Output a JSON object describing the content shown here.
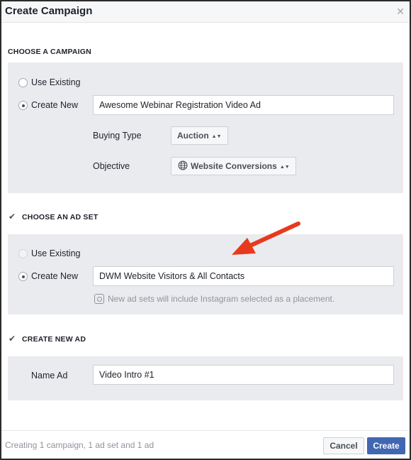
{
  "dialog": {
    "title": "Create Campaign",
    "close_glyph": "✕"
  },
  "campaign_section": {
    "label": "CHOOSE A CAMPAIGN",
    "use_existing_label": "Use Existing",
    "create_new_label": "Create New",
    "name_value": "Awesome Webinar Registration Video Ad",
    "buying_type_label": "Buying Type",
    "buying_type_value": "Auction",
    "objective_label": "Objective",
    "objective_value": "Website Conversions"
  },
  "ad_set_section": {
    "label": "CHOOSE AN AD SET",
    "checked": true,
    "use_existing_label": "Use Existing",
    "create_new_label": "Create New",
    "name_value": "DWM Website Visitors & All Contacts",
    "instagram_note": "New ad sets will include Instagram selected as a placement."
  },
  "ad_section": {
    "label": "CREATE NEW AD",
    "checked": true,
    "name_label": "Name Ad",
    "name_value": "Video Intro #1"
  },
  "footer": {
    "status": "Creating 1 campaign, 1 ad set and 1 ad",
    "cancel_label": "Cancel",
    "create_label": "Create"
  },
  "colors": {
    "primary_button": "#4267b2",
    "panel_bg": "#e9ebee",
    "annotation_arrow": "#e8391e"
  },
  "icons": {
    "close": "close-icon",
    "checkbox": "checkmark-icon",
    "select": "up-down-caret-icon",
    "objective": "globe-icon",
    "note": "instagram-icon",
    "annotation": "arrow-icon"
  }
}
